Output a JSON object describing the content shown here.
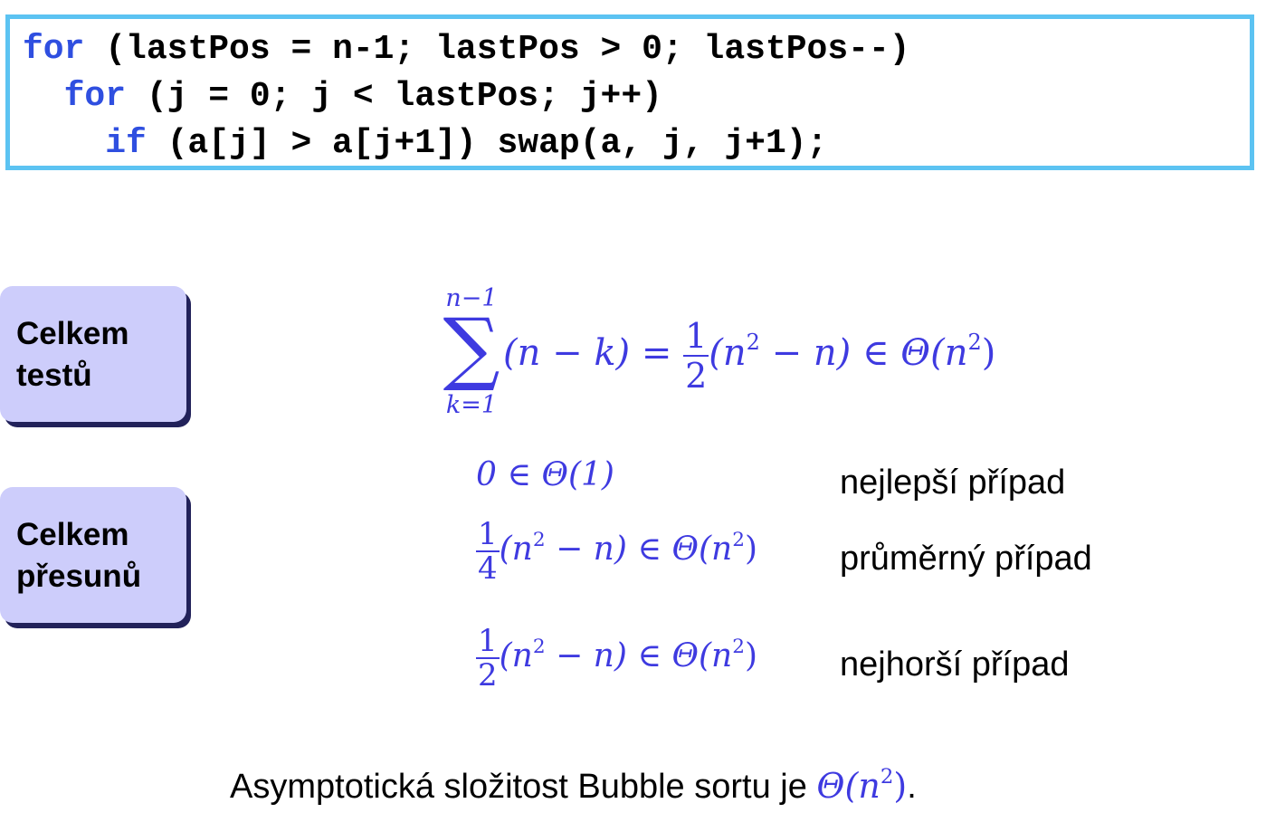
{
  "code": {
    "line1": {
      "kw": "for",
      "rest": " (lastPos = n-1; lastPos > 0; lastPos--)"
    },
    "line2": {
      "indent": "  ",
      "kw": "for",
      "rest": " (j = 0; j < lastPos; j++)"
    },
    "line3": {
      "indent": "    ",
      "kw": "if",
      "rest": " (a[j] > a[j+1]) swap(a, j, j+1);"
    }
  },
  "labels": {
    "tests": {
      "line1": "Celkem",
      "line2": "testů"
    },
    "moves": {
      "line1": "Celkem",
      "line2": "přesunů"
    }
  },
  "sum_formula": {
    "upper": "n−1",
    "lower": "k=1",
    "term": "(n − k) =",
    "frac_num": "1",
    "frac_den": "2",
    "after": "(n",
    "after_exp": "2",
    "after2": " − n) ∈ Θ(n",
    "after2_exp": "2",
    "after3": ")"
  },
  "cases": {
    "best": {
      "formula": "0 ∈ Θ(1)",
      "label": "nejlepší případ"
    },
    "average": {
      "frac_num": "1",
      "frac_den": "4",
      "formula_a": "(n",
      "formula_exp": "2",
      "formula_b": " − n) ∈ Θ(n",
      "formula_exp2": "2",
      "formula_c": ")",
      "label": "průměrný případ"
    },
    "worst": {
      "frac_num": "1",
      "frac_den": "2",
      "formula_a": "(n",
      "formula_exp": "2",
      "formula_b": " − n) ∈ Θ(n",
      "formula_exp2": "2",
      "formula_c": ")",
      "label": "nejhorší případ"
    }
  },
  "conclusion": {
    "text": "Asymptotická složitost Bubble sortu je ",
    "math_a": "Θ(n",
    "math_exp": "2",
    "math_b": ")",
    "end": "."
  },
  "colors": {
    "accent_border": "#5cc3f2",
    "keyword": "#2f4fe0",
    "math": "#3e3ae0",
    "label_box": "#cdcdfb"
  }
}
